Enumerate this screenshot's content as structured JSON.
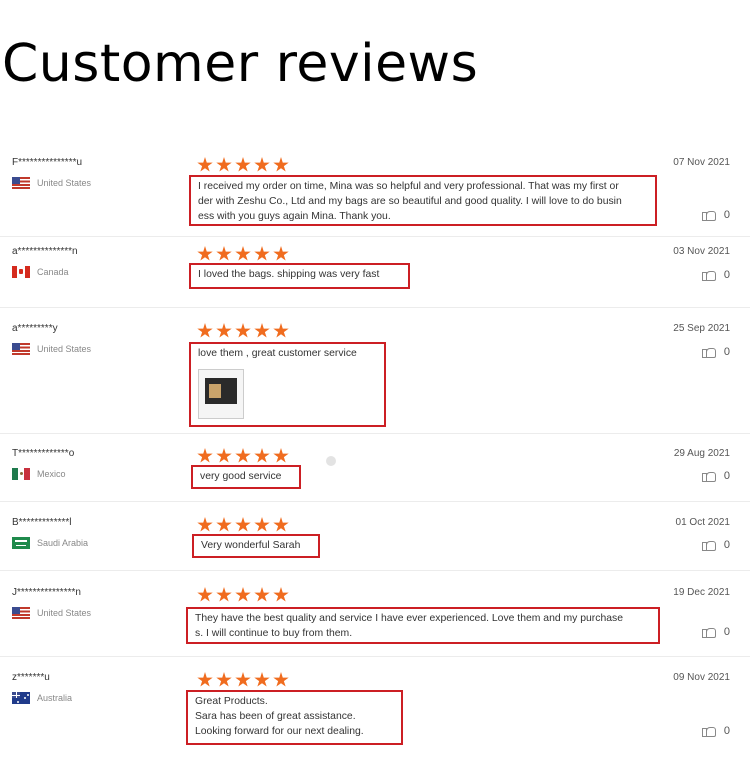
{
  "page": {
    "title": "Customer reviews"
  },
  "reviews": [
    {
      "user": "F***************u",
      "country": "United States",
      "flag": "us",
      "date": "07 Nov 2021",
      "stars": 5,
      "likes": "0",
      "text": [
        "I received my order on time, Mina was so helpful and very professional. That was my first or",
        "der with Zeshu Co., Ltd and my bags are so beautiful and good quality. I will love to do busin",
        "ess with you guys again Mina. Thank you."
      ]
    },
    {
      "user": "a**************n",
      "country": "Canada",
      "flag": "ca",
      "date": "03 Nov 2021",
      "stars": 5,
      "likes": "0",
      "text": [
        "I loved the bags.  shipping was very fast"
      ]
    },
    {
      "user": "a*********y",
      "country": "United States",
      "flag": "us",
      "date": "25 Sep 2021",
      "stars": 5,
      "likes": "0",
      "text": [
        "love them , great customer service"
      ]
    },
    {
      "user": "T*************o",
      "country": "Mexico",
      "flag": "mx",
      "date": "29 Aug 2021",
      "stars": 5,
      "likes": "0",
      "text": [
        "very good service"
      ]
    },
    {
      "user": "B*************l",
      "country": "Saudi Arabia",
      "flag": "sa",
      "date": "01 Oct 2021",
      "stars": 5,
      "likes": "0",
      "text": [
        "Very wonderful Sarah"
      ]
    },
    {
      "user": "J***************n",
      "country": "United States",
      "flag": "us",
      "date": "19 Dec 2021",
      "stars": 5,
      "likes": "0",
      "text": [
        "They have the best quality and service I have ever experienced. Love them and my purchase",
        "s. I will continue to buy from them."
      ]
    },
    {
      "user": "z*******u",
      "country": "Australia",
      "flag": "au",
      "date": "09 Nov 2021",
      "stars": 5,
      "likes": "0",
      "text": [
        "Great Products.",
        "Sara has been of great assistance.",
        "Looking forward for our next dealing."
      ]
    }
  ],
  "colors": {
    "star": "#f06c1f",
    "highlight_border": "#cc1f24"
  }
}
